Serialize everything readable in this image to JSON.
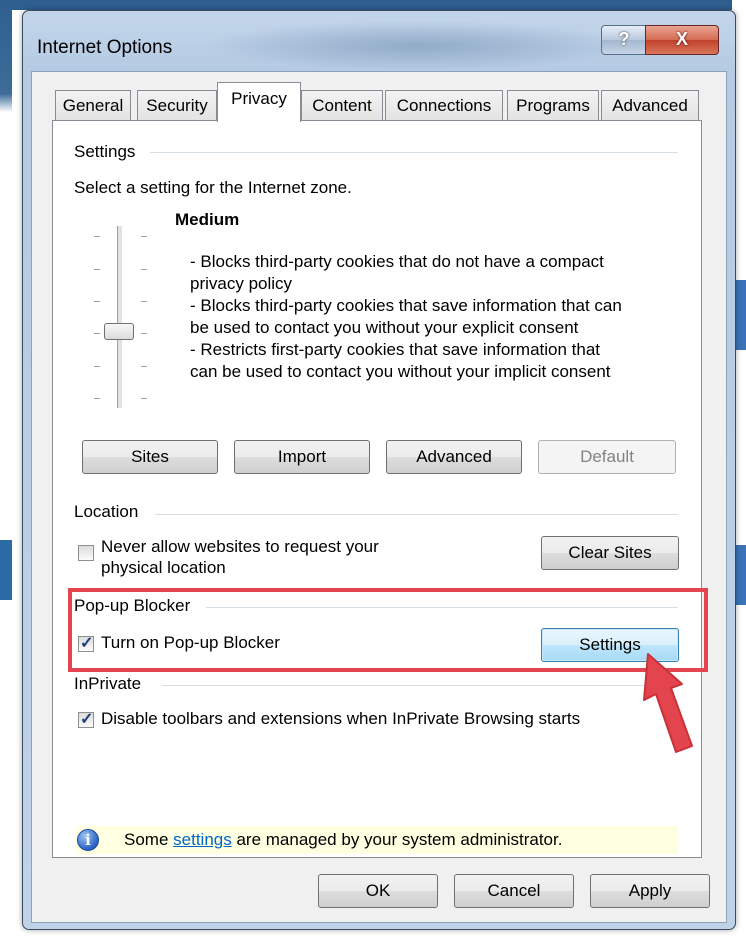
{
  "window": {
    "title": "Internet Options",
    "help_label": "?",
    "close_label": "X"
  },
  "tabs": [
    "General",
    "Security",
    "Privacy",
    "Content",
    "Connections",
    "Programs",
    "Advanced"
  ],
  "active_tab": "Privacy",
  "settings": {
    "group_label": "Settings",
    "instruction": "Select a setting for the Internet zone.",
    "level": "Medium",
    "description_lines": [
      "- Blocks third-party cookies that do not have a compact",
      "privacy policy",
      "- Blocks third-party cookies that save information that can",
      "be used to contact you without your explicit consent",
      "- Restricts first-party cookies that save information that",
      "can be used to contact you without your implicit consent"
    ],
    "buttons": {
      "sites": "Sites",
      "import": "Import",
      "advanced": "Advanced",
      "default": "Default"
    }
  },
  "location": {
    "group_label": "Location",
    "checkbox_line1": "Never allow websites to request your",
    "checkbox_line2": "physical location",
    "checked": false,
    "clear_sites": "Clear Sites"
  },
  "popup": {
    "group_label": "Pop-up Blocker",
    "checkbox_label": "Turn on Pop-up Blocker",
    "checked": true,
    "settings_button": "Settings"
  },
  "inprivate": {
    "group_label": "InPrivate",
    "checkbox_label": "Disable toolbars and extensions when InPrivate Browsing starts",
    "checked": true
  },
  "info": {
    "before": "Some ",
    "link": "settings",
    "after": " are managed by your system administrator."
  },
  "footer": {
    "ok": "OK",
    "cancel": "Cancel",
    "apply": "Apply"
  },
  "annotation_color": "#e3444d"
}
